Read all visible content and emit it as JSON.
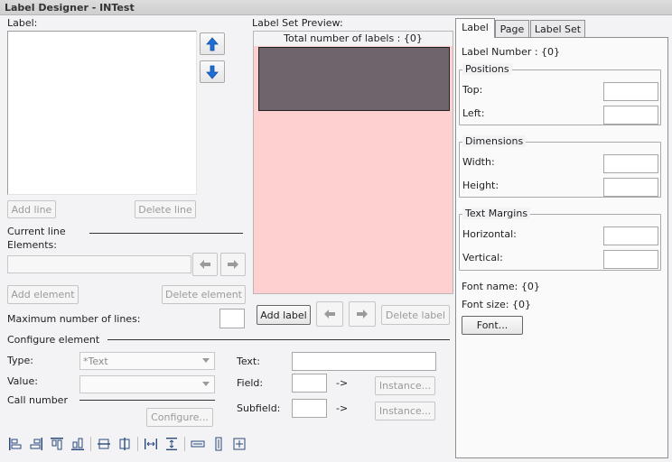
{
  "window": {
    "title": "Label Designer - INTest"
  },
  "left": {
    "label_heading": "Label:",
    "add_line": "Add line",
    "delete_line": "Delete line",
    "current_line": "Current line",
    "elements": "Elements:",
    "add_element": "Add element",
    "delete_element": "Delete element",
    "max_lines": "Maximum number of lines:",
    "configure_element": "Configure element",
    "type_label": "Type:",
    "type_value": "*Text",
    "value_label": "Value:",
    "call_number": "Call number",
    "configure_btn": "Configure...",
    "text_label": "Text:",
    "field_label": "Field:",
    "subfield_label": "Subfield:",
    "arrow_text": "->",
    "instance_btn": "Instance..."
  },
  "preview": {
    "heading": "Label Set Preview:",
    "total": "Total number of labels : {0}",
    "add_label": "Add label",
    "delete_label": "Delete label",
    "colors": {
      "label_block": "#6e656c",
      "background": "#ffd0d0"
    }
  },
  "tabs": {
    "label": "Label",
    "page": "Page",
    "label_set": "Label Set"
  },
  "right": {
    "label_number": "Label Number : {0}",
    "positions": "Positions",
    "top": "Top:",
    "left": "Left:",
    "dimensions": "Dimensions",
    "width": "Width:",
    "height": "Height:",
    "text_margins": "Text Margins",
    "horizontal": "Horizontal:",
    "vertical": "Vertical:",
    "font_name": "Font name: {0}",
    "font_size": "Font size: {0}",
    "font_btn": "Font..."
  },
  "toolbar": {
    "icons": [
      "align-left-icon",
      "align-right-icon",
      "align-top-icon",
      "align-bottom-icon",
      "center-vertical-icon",
      "center-horizontal-icon",
      "space-horizontal-icon",
      "space-vertical-icon",
      "same-width-icon",
      "same-height-icon",
      "same-size-icon"
    ]
  }
}
